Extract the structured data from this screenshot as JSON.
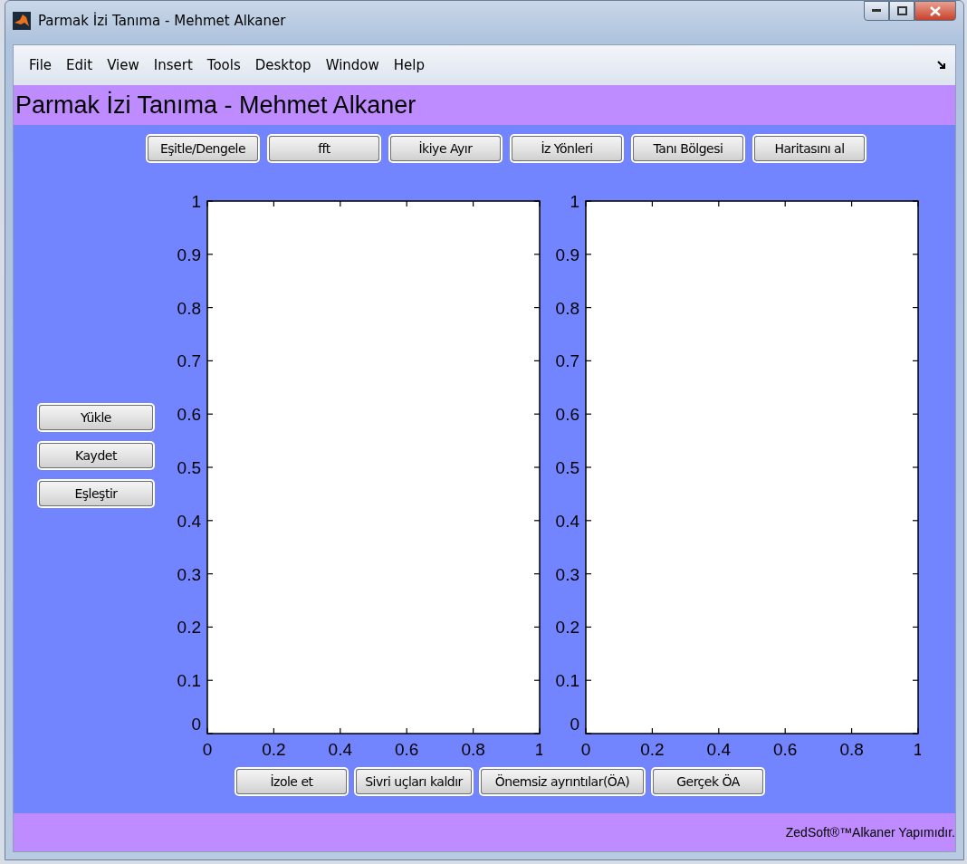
{
  "window": {
    "title": "Parmak İzi Tanıma - Mehmet Alkaner"
  },
  "menu": [
    "File",
    "Edit",
    "View",
    "Insert",
    "Tools",
    "Desktop",
    "Window",
    "Help"
  ],
  "header": "Parmak İzi Tanıma - Mehmet Alkaner",
  "top_buttons": [
    "Eşitle/Dengele",
    "fft",
    "İkiye Ayır",
    "İz Yönleri",
    "Tanı Bölgesi",
    "Haritasını al"
  ],
  "side_buttons": [
    "Yükle",
    "Kaydet",
    "Eşleştir"
  ],
  "plots": [
    {
      "chart_data": {
        "type": "line",
        "xlim": [
          0,
          1
        ],
        "ylim": [
          0,
          1
        ],
        "xticks": [
          0,
          0.2,
          0.4,
          0.6,
          0.8,
          1
        ],
        "yticks": [
          0,
          0.1,
          0.2,
          0.3,
          0.4,
          0.5,
          0.6,
          0.7,
          0.8,
          0.9,
          1
        ]
      }
    },
    {
      "chart_data": {
        "type": "line",
        "xlim": [
          0,
          1
        ],
        "ylim": [
          0,
          1
        ],
        "xticks": [
          0,
          0.2,
          0.4,
          0.6,
          0.8,
          1
        ],
        "yticks": [
          0,
          0.1,
          0.2,
          0.3,
          0.4,
          0.5,
          0.6,
          0.7,
          0.8,
          0.9,
          1
        ]
      }
    }
  ],
  "bottom_buttons": [
    "İzole et",
    "Sivri uçları kaldır",
    "Önemsiz ayrıntılar(ÖA)",
    "Gerçek ÖA"
  ],
  "footer": "ZedSoft®™Alkaner Yapımıdır."
}
